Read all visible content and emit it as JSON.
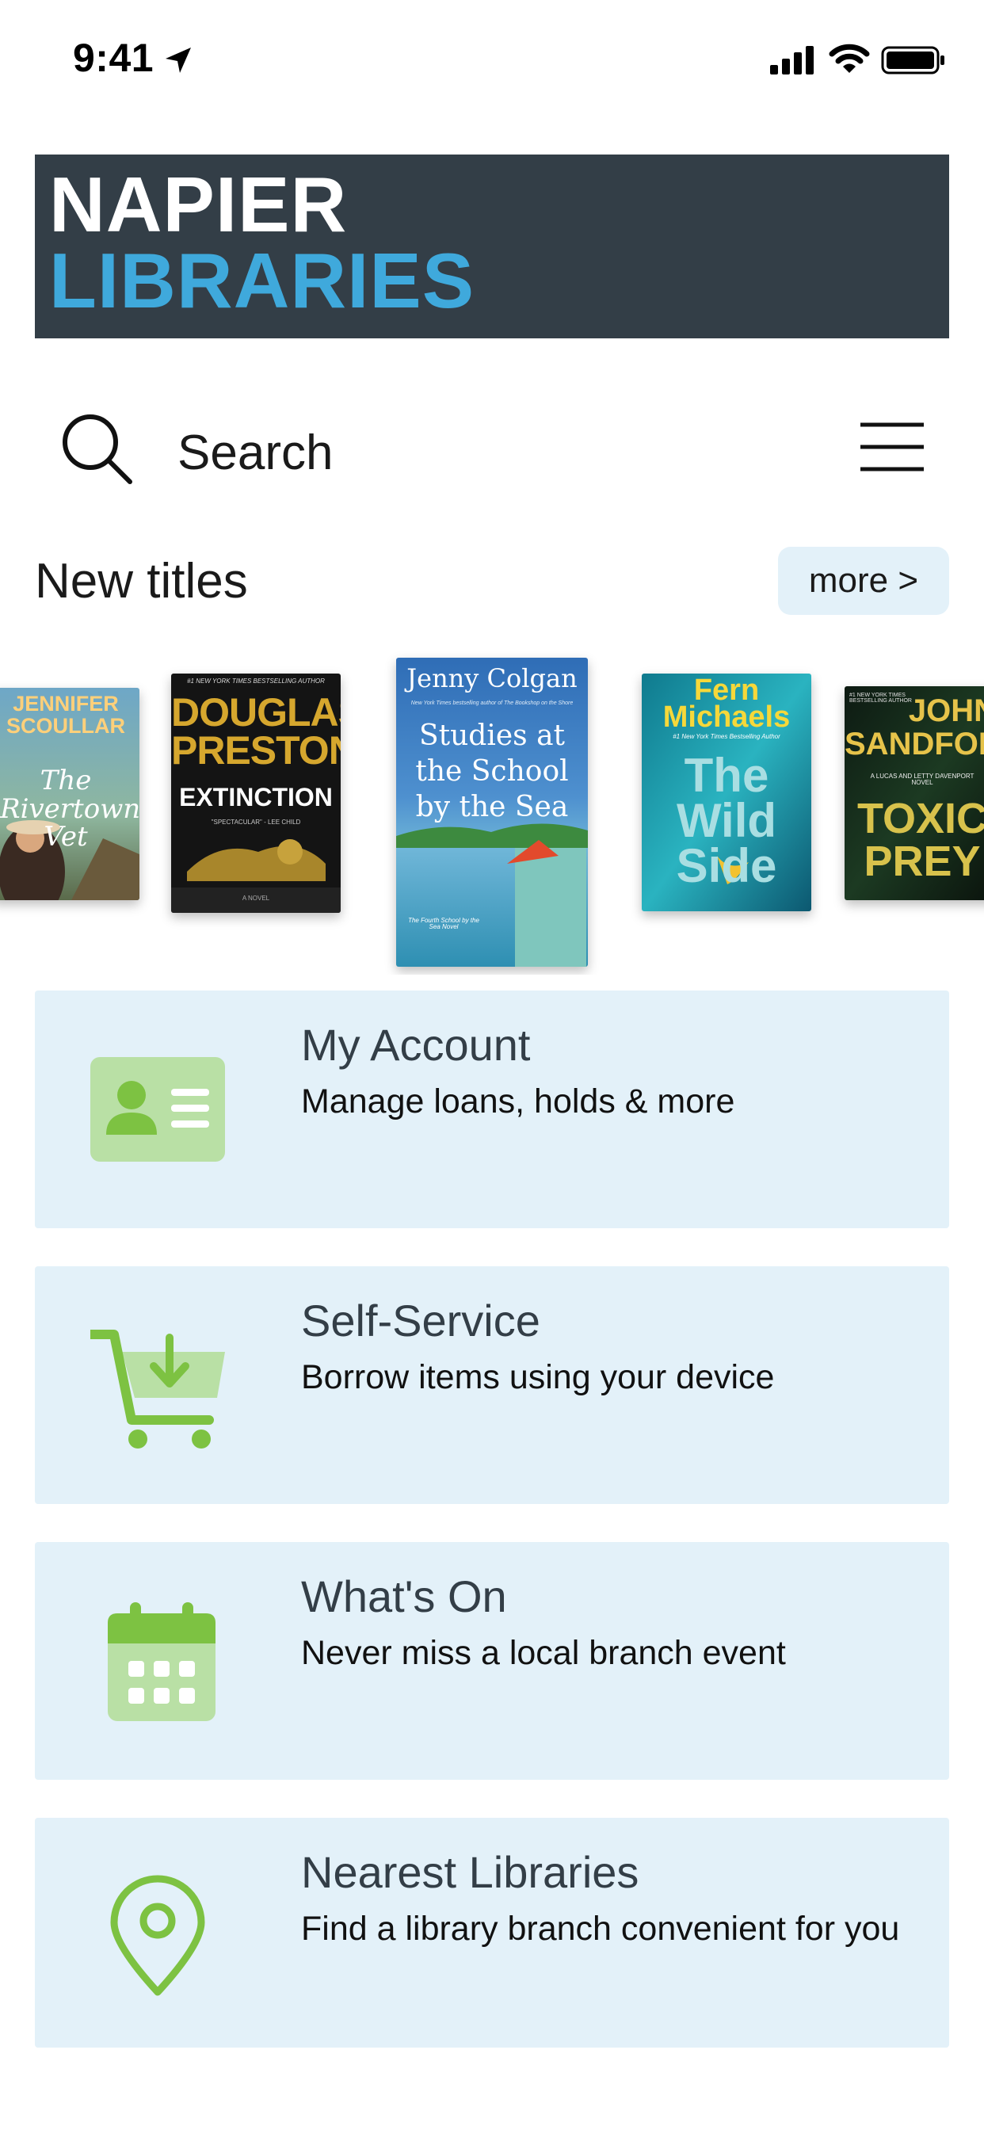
{
  "status_bar": {
    "time": "9:41"
  },
  "logo": {
    "line1": "NAPIER",
    "line2": "LIBRARIES",
    "background": "#333e47",
    "accent": "#3fa9dc"
  },
  "search": {
    "label": "Search"
  },
  "new_titles": {
    "heading": "New titles",
    "more_label": "more >",
    "books": [
      {
        "author": "JENNIFER SCOULLAR",
        "title": "The Rivertown Vet"
      },
      {
        "author": "DOUGLAS PRESTON",
        "title": "EXTINCTION",
        "tagline": "#1 NEW YORK TIMES BESTSELLING AUTHOR",
        "quote": "\"SPECTACULAR\" - LEE CHILD",
        "extra": "A NOVEL"
      },
      {
        "author": "Jenny Colgan",
        "title": "Studies at the School by the Sea",
        "tagline": "New York Times bestselling author of The Bookshop on the Shore",
        "extra": "The Fourth School by the Sea Novel"
      },
      {
        "author": "Fern Michaels",
        "title": "The Wild Side",
        "tagline": "#1 New York Times Bestselling Author"
      },
      {
        "author": "JOHN SANDFORD",
        "title": "TOXIC PREY",
        "tagline": "#1 NEW YORK TIMES BESTSELLING AUTHOR",
        "extra": "A LUCAS AND LETTY DAVENPORT NOVEL"
      }
    ]
  },
  "menu": [
    {
      "title": "My Account",
      "subtitle": "Manage loans, holds & more",
      "icon": "account-card-icon"
    },
    {
      "title": "Self-Service",
      "subtitle": "Borrow items using your device",
      "icon": "cart-download-icon"
    },
    {
      "title": "What's On",
      "subtitle": "Never miss a local branch event",
      "icon": "calendar-icon"
    },
    {
      "title": "Nearest Libraries",
      "subtitle": "Find a library branch convenient for you",
      "icon": "map-pin-icon"
    }
  ],
  "colors": {
    "card_bg": "#e3f1f9",
    "icon_green": "#7dc242",
    "icon_light_green": "#b9e0a5"
  }
}
